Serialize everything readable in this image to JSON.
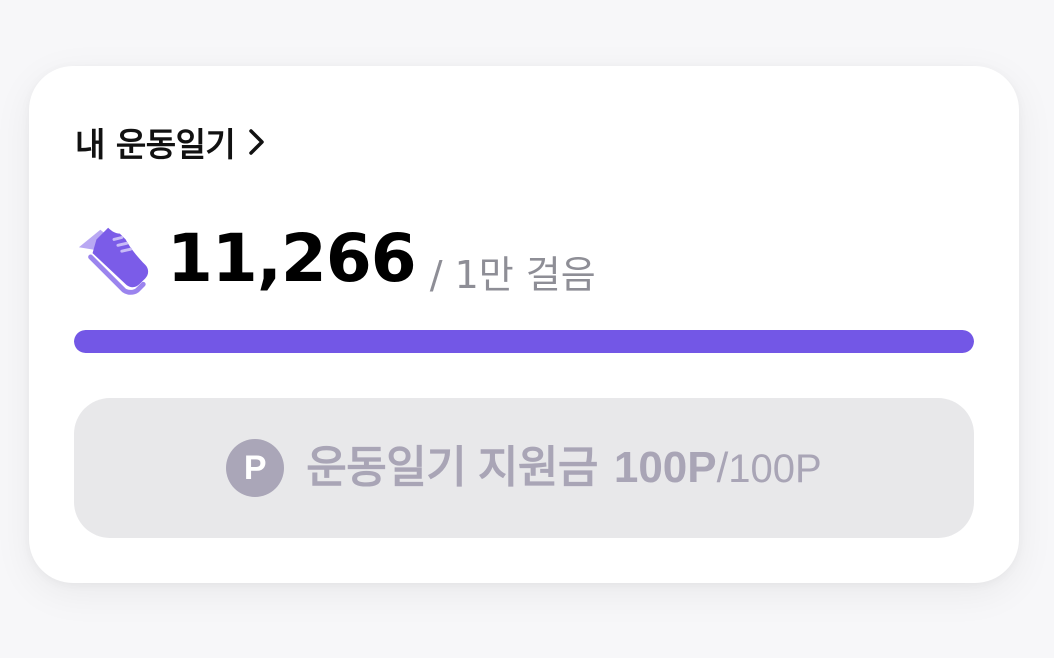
{
  "diary": {
    "title": "내 운동일기",
    "chevron_icon": "chevron-right-icon"
  },
  "steps": {
    "icon": "running-shoe-icon",
    "count": "11,266",
    "goal": "/ 1만 걸음",
    "progress": 1.0
  },
  "reward": {
    "badge": "P",
    "label": "운동일기 지원금",
    "earned": "100P",
    "separator": "/",
    "max": "100P"
  },
  "colors": {
    "accent": "#7357e6",
    "shoe_main": "#7b5ce8",
    "shoe_light": "#b9a8f3",
    "reward_text": "#a9a5b6",
    "reward_bg": "#e8e8ea"
  }
}
